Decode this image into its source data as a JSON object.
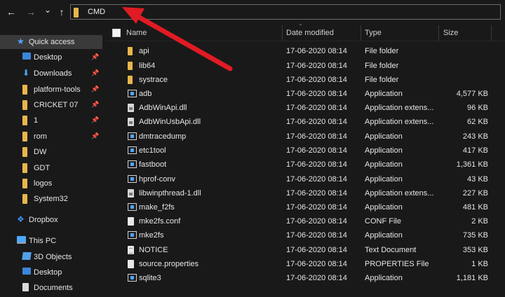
{
  "nav": {
    "back_glyph": "←",
    "forward_glyph": "→",
    "history_glyph": "⌄",
    "up_glyph": "↑",
    "address": "CMD"
  },
  "sidebar": {
    "items": [
      {
        "label": "Quick access",
        "icon": "star-icon",
        "pinned": false
      },
      {
        "label": "Desktop",
        "icon": "desktop-icon",
        "pinned": true
      },
      {
        "label": "Downloads",
        "icon": "download-icon",
        "pinned": true
      },
      {
        "label": "platform-tools",
        "icon": "folder-icon",
        "pinned": true
      },
      {
        "label": "CRICKET 07",
        "icon": "folder-icon",
        "pinned": true
      },
      {
        "label": "1",
        "icon": "folder-icon",
        "pinned": true
      },
      {
        "label": "rom",
        "icon": "folder-icon",
        "pinned": true
      },
      {
        "label": "DW",
        "icon": "folder-icon",
        "pinned": false
      },
      {
        "label": "GDT",
        "icon": "folder-icon",
        "pinned": false
      },
      {
        "label": "logos",
        "icon": "folder-icon",
        "pinned": false
      },
      {
        "label": "System32",
        "icon": "folder-icon",
        "pinned": false
      },
      {
        "label": "Dropbox",
        "icon": "dropbox-icon",
        "pinned": false
      },
      {
        "label": "This PC",
        "icon": "computer-icon",
        "pinned": false
      },
      {
        "label": "3D Objects",
        "icon": "cube-icon",
        "pinned": false
      },
      {
        "label": "Desktop",
        "icon": "desktop-icon",
        "pinned": false
      },
      {
        "label": "Documents",
        "icon": "document-icon",
        "pinned": false
      }
    ]
  },
  "columns": {
    "name": "Name",
    "date": "Date modified",
    "type": "Type",
    "size": "Size"
  },
  "files": [
    {
      "name": "api",
      "date": "17-06-2020 08:14",
      "type": "File folder",
      "size": "",
      "icon": "folder-icon"
    },
    {
      "name": "lib64",
      "date": "17-06-2020 08:14",
      "type": "File folder",
      "size": "",
      "icon": "folder-icon"
    },
    {
      "name": "systrace",
      "date": "17-06-2020 08:14",
      "type": "File folder",
      "size": "",
      "icon": "folder-icon"
    },
    {
      "name": "adb",
      "date": "17-06-2020 08:14",
      "type": "Application",
      "size": "4,577 KB",
      "icon": "application-icon"
    },
    {
      "name": "AdbWinApi.dll",
      "date": "17-06-2020 08:14",
      "type": "Application extens...",
      "size": "96 KB",
      "icon": "dll-icon"
    },
    {
      "name": "AdbWinUsbApi.dll",
      "date": "17-06-2020 08:14",
      "type": "Application extens...",
      "size": "62 KB",
      "icon": "dll-icon"
    },
    {
      "name": "dmtracedump",
      "date": "17-06-2020 08:14",
      "type": "Application",
      "size": "243 KB",
      "icon": "application-icon"
    },
    {
      "name": "etc1tool",
      "date": "17-06-2020 08:14",
      "type": "Application",
      "size": "417 KB",
      "icon": "application-icon"
    },
    {
      "name": "fastboot",
      "date": "17-06-2020 08:14",
      "type": "Application",
      "size": "1,361 KB",
      "icon": "application-icon"
    },
    {
      "name": "hprof-conv",
      "date": "17-06-2020 08:14",
      "type": "Application",
      "size": "43 KB",
      "icon": "application-icon"
    },
    {
      "name": "libwinpthread-1.dll",
      "date": "17-06-2020 08:14",
      "type": "Application extens...",
      "size": "227 KB",
      "icon": "dll-icon"
    },
    {
      "name": "make_f2fs",
      "date": "17-06-2020 08:14",
      "type": "Application",
      "size": "481 KB",
      "icon": "application-icon"
    },
    {
      "name": "mke2fs.conf",
      "date": "17-06-2020 08:14",
      "type": "CONF File",
      "size": "2 KB",
      "icon": "file-icon"
    },
    {
      "name": "mke2fs",
      "date": "17-06-2020 08:14",
      "type": "Application",
      "size": "735 KB",
      "icon": "application-icon"
    },
    {
      "name": "NOTICE",
      "date": "17-06-2020 08:14",
      "type": "Text Document",
      "size": "353 KB",
      "icon": "text-document-icon"
    },
    {
      "name": "source.properties",
      "date": "17-06-2020 08:14",
      "type": "PROPERTIES File",
      "size": "1 KB",
      "icon": "file-icon"
    },
    {
      "name": "sqlite3",
      "date": "17-06-2020 08:14",
      "type": "Application",
      "size": "1,181 KB",
      "icon": "application-icon"
    }
  ],
  "colors": {
    "background": "#191919",
    "folder": "#e8b64b",
    "accent_blue": "#4fa7ff",
    "annotation_arrow": "#e01b24"
  }
}
